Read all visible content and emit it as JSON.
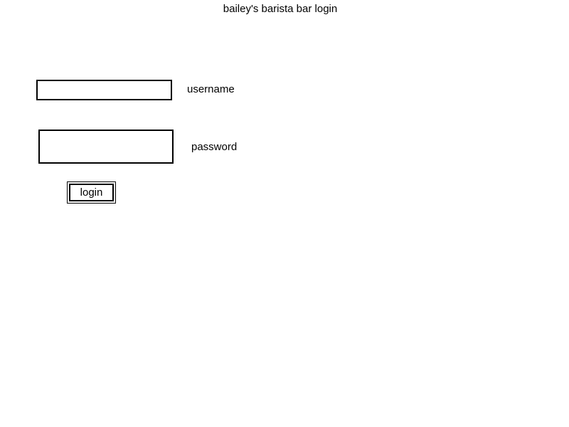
{
  "page": {
    "title": "bailey's barista bar login"
  },
  "form": {
    "username": {
      "label": "username",
      "value": ""
    },
    "password": {
      "label": "password",
      "value": ""
    },
    "login_button": {
      "label": "login"
    }
  }
}
